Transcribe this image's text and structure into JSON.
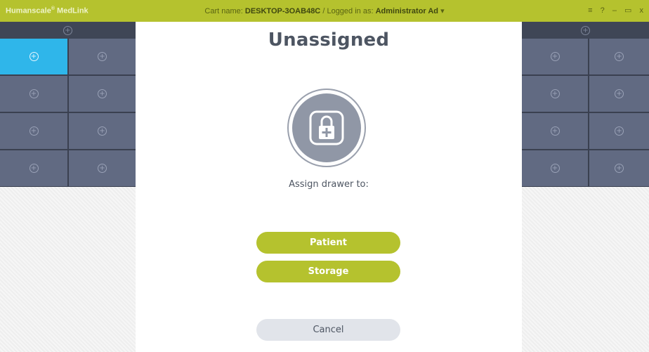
{
  "titlebar": {
    "app_name": "Humanscale",
    "app_name_mark": "®",
    "app_name_suffix": " MedLink",
    "cart_label": "Cart name:",
    "cart_name": "DESKTOP-3OAB48C",
    "separator": "/",
    "logged_label": "Logged in as:",
    "user": "Administrator Ad",
    "user_menu_arrow": "▾",
    "controls": {
      "menu": "≡",
      "help": "?",
      "minimize": "–",
      "restore": "▭",
      "close": "x"
    }
  },
  "drawers": {
    "plus_glyph": "+",
    "left_columns": 2,
    "left_rows": 4,
    "right_columns": 2,
    "right_rows": 4
  },
  "dialog": {
    "title": "Unassigned",
    "icon": "lock-plus-icon",
    "assign_label": "Assign drawer to:",
    "patient_button": "Patient",
    "storage_button": "Storage",
    "cancel_button": "Cancel"
  },
  "colors": {
    "accent": "#b5c22e",
    "active_drawer": "#2fb6ea",
    "drawer": "#616a82"
  }
}
